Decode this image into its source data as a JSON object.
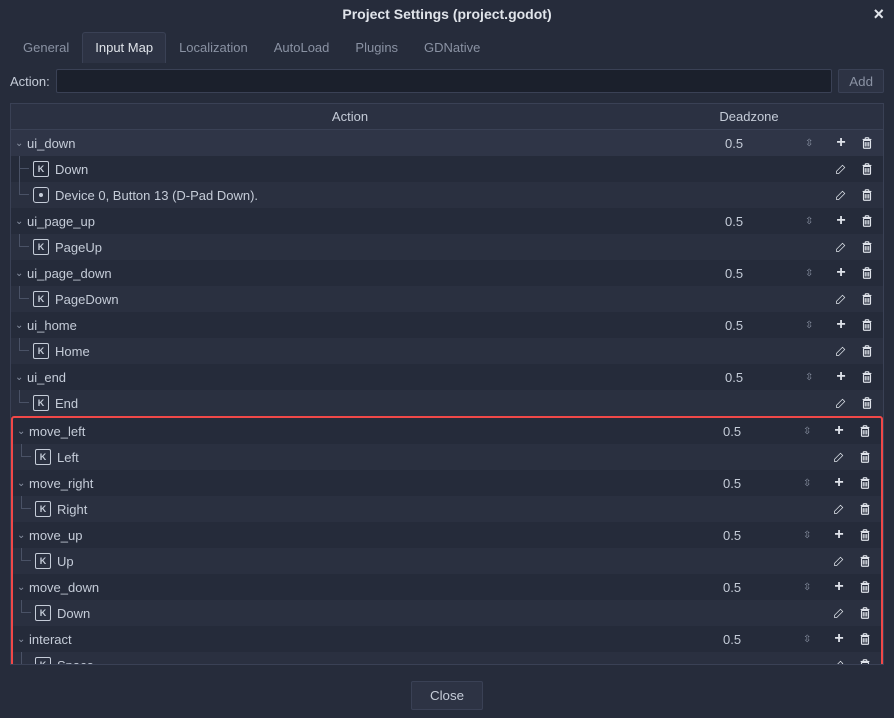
{
  "window": {
    "title": "Project Settings (project.godot)"
  },
  "tabs": [
    {
      "label": "General",
      "active": false
    },
    {
      "label": "Input Map",
      "active": true
    },
    {
      "label": "Localization",
      "active": false
    },
    {
      "label": "AutoLoad",
      "active": false
    },
    {
      "label": "Plugins",
      "active": false
    },
    {
      "label": "GDNative",
      "active": false
    }
  ],
  "action_bar": {
    "label": "Action:",
    "value": "",
    "add_label": "Add"
  },
  "columns": {
    "action": "Action",
    "deadzone": "Deadzone"
  },
  "actions": [
    {
      "name": "ui_down",
      "deadzone": "0.5",
      "partial": true,
      "events": [
        {
          "kind": "key",
          "label": "Down"
        },
        {
          "kind": "joy",
          "label": "Device 0, Button 13 (D-Pad Down)."
        }
      ]
    },
    {
      "name": "ui_page_up",
      "deadzone": "0.5",
      "events": [
        {
          "kind": "key",
          "label": "PageUp"
        }
      ]
    },
    {
      "name": "ui_page_down",
      "deadzone": "0.5",
      "events": [
        {
          "kind": "key",
          "label": "PageDown"
        }
      ]
    },
    {
      "name": "ui_home",
      "deadzone": "0.5",
      "events": [
        {
          "kind": "key",
          "label": "Home"
        }
      ]
    },
    {
      "name": "ui_end",
      "deadzone": "0.5",
      "events": [
        {
          "kind": "key",
          "label": "End"
        }
      ]
    },
    {
      "name": "move_left",
      "deadzone": "0.5",
      "highlighted": true,
      "events": [
        {
          "kind": "key",
          "label": "Left"
        }
      ]
    },
    {
      "name": "move_right",
      "deadzone": "0.5",
      "highlighted": true,
      "events": [
        {
          "kind": "key",
          "label": "Right"
        }
      ]
    },
    {
      "name": "move_up",
      "deadzone": "0.5",
      "highlighted": true,
      "events": [
        {
          "kind": "key",
          "label": "Up"
        }
      ]
    },
    {
      "name": "move_down",
      "deadzone": "0.5",
      "highlighted": true,
      "events": [
        {
          "kind": "key",
          "label": "Down"
        }
      ]
    },
    {
      "name": "interact",
      "deadzone": "0.5",
      "highlighted": true,
      "events": [
        {
          "kind": "key",
          "label": "Space"
        }
      ]
    }
  ],
  "footer": {
    "close_label": "Close"
  }
}
